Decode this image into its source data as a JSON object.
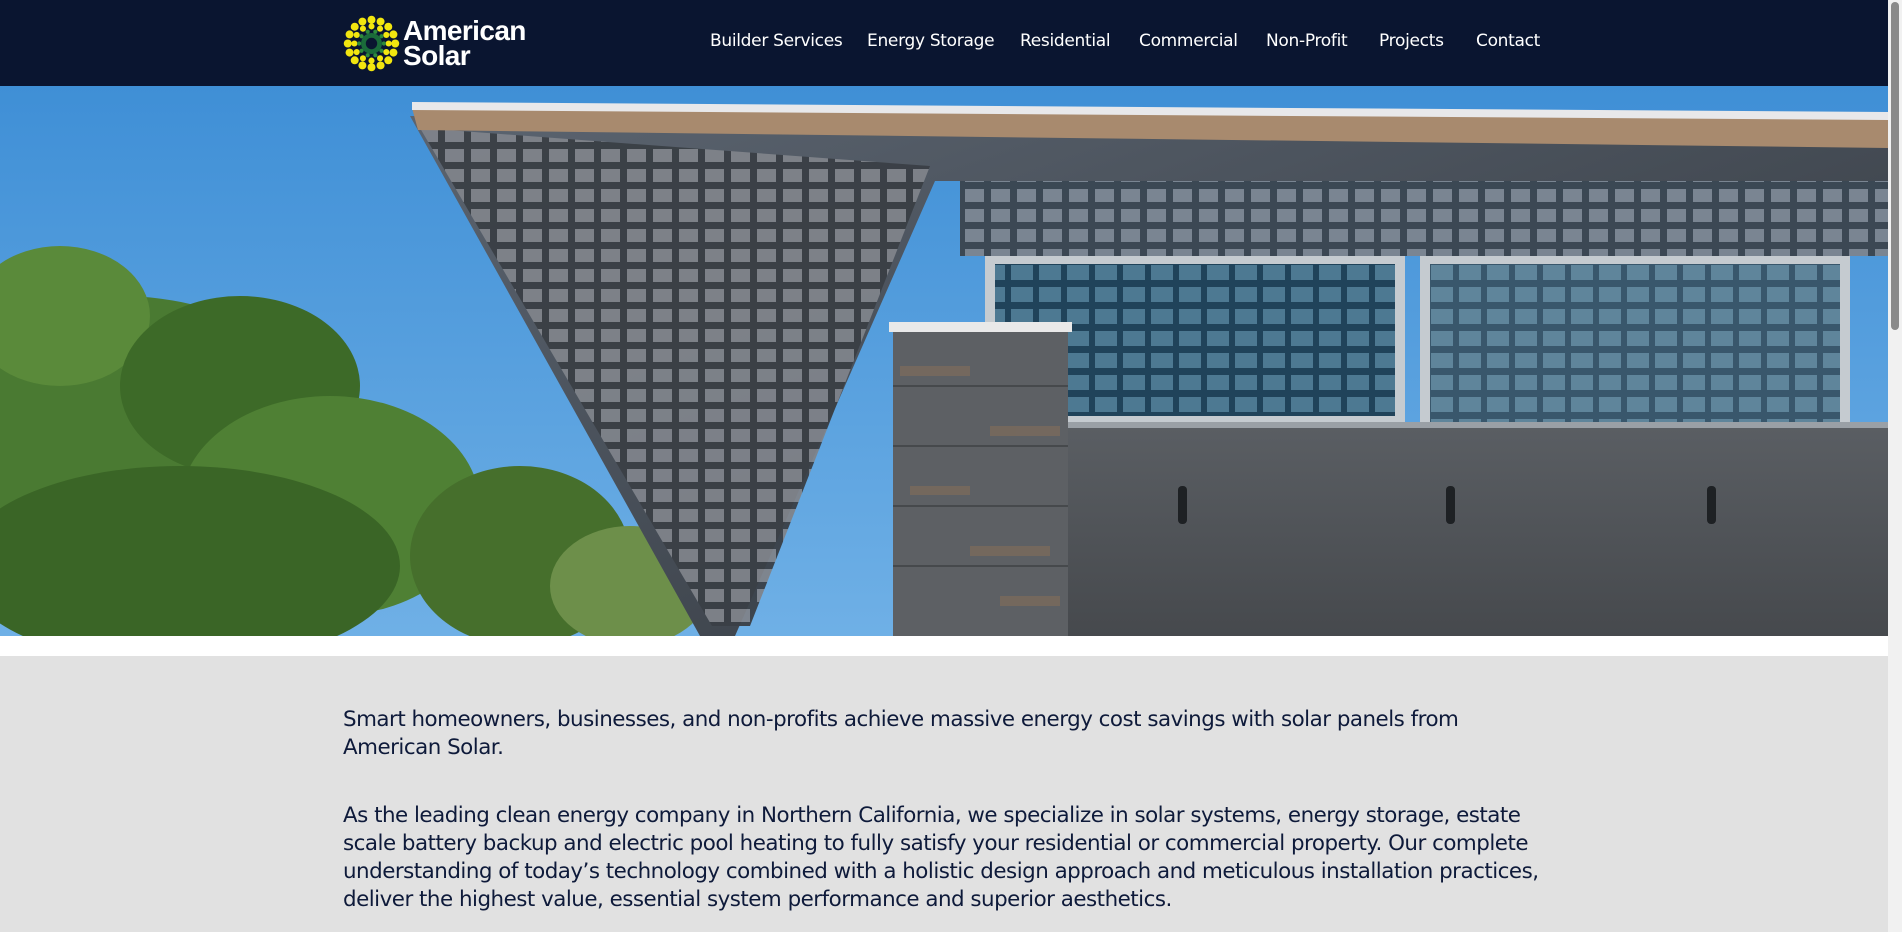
{
  "brand": {
    "logo_line1": "American",
    "logo_line2": "Solar",
    "logo_colors": {
      "yellow": "#f2e60f",
      "green": "#2e8b3c",
      "navy": "#0a1530"
    }
  },
  "nav": {
    "items": [
      {
        "label": "Builder Services"
      },
      {
        "label": "Energy Storage"
      },
      {
        "label": "Residential"
      },
      {
        "label": "Commercial"
      },
      {
        "label": "Non-Profit"
      },
      {
        "label": "Projects"
      },
      {
        "label": "Contact"
      }
    ]
  },
  "hero": {
    "description": "",
    "colors": {
      "sky": "#4596da",
      "wall": "#505458",
      "trees": "#3f6b2a"
    }
  },
  "main": {
    "intro": "Smart homeowners, businesses, and non-profits achieve massive energy cost savings with solar panels from American Solar.",
    "body": "As the leading clean energy company in Northern California, we specialize in  solar systems, energy storage, estate scale battery backup and electric pool heating to fully satisfy your residential or commercial property. Our complete understanding of today’s technology combined with a holistic design approach and meticulous installation practices, deliver the highest value, essential system performance and superior aesthetics."
  },
  "colors": {
    "header_bg": "#0a1530",
    "content_bg": "#e1e1e1",
    "text": "#0e1a3a"
  }
}
